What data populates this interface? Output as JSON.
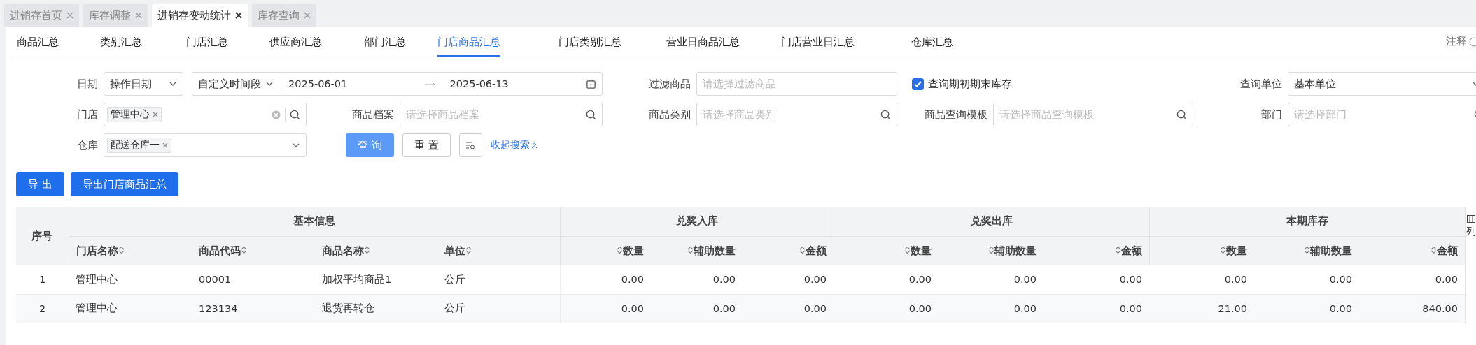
{
  "open_tabs": [
    {
      "label": "进销存首页",
      "selected": false
    },
    {
      "label": "库存调整",
      "selected": false
    },
    {
      "label": "进销存变动统计",
      "selected": true
    },
    {
      "label": "库存查询",
      "selected": false
    }
  ],
  "report_tabs": [
    {
      "label": "商品汇总",
      "selected": false
    },
    {
      "label": "类别汇总",
      "selected": false
    },
    {
      "label": "门店汇总",
      "selected": false
    },
    {
      "label": "供应商汇总",
      "selected": false
    },
    {
      "label": "部门汇总",
      "selected": false
    },
    {
      "label": "门店商品汇总",
      "selected": true
    },
    {
      "label": "门店类别汇总",
      "selected": false
    },
    {
      "label": "营业日商品汇总",
      "selected": false
    },
    {
      "label": "门店营业日汇总",
      "selected": false
    },
    {
      "label": "仓库汇总",
      "selected": false
    }
  ],
  "help_link": "注释",
  "filters": {
    "date": {
      "label": "日期",
      "type_value": "操作日期",
      "range_value": "自定义时间段",
      "start": "2025-06-01",
      "end": "2025-06-13"
    },
    "filter_goods": {
      "label": "过滤商品",
      "placeholder": "请选择过滤商品"
    },
    "opening_closing_stock": {
      "label": "查询期初期末库存",
      "checked": true
    },
    "query_unit": {
      "label": "查询单位",
      "value": "基本单位"
    },
    "store": {
      "label": "门店",
      "tags": [
        "管理中心"
      ]
    },
    "goods_file": {
      "label": "商品档案",
      "placeholder": "请选择商品档案"
    },
    "goods_category": {
      "label": "商品类别",
      "placeholder": "请选择商品类别"
    },
    "query_template": {
      "label": "商品查询模板",
      "placeholder": "请选择商品查询模板"
    },
    "department": {
      "label": "部门",
      "placeholder": "请选择部门"
    },
    "warehouse": {
      "label": "仓库",
      "tags": [
        "配送仓库一"
      ]
    }
  },
  "search_actions": {
    "query": "查 询",
    "reset": "重 置",
    "collapse": "收起搜索"
  },
  "export_buttons": [
    "导 出",
    "导出门店商品汇总"
  ],
  "table": {
    "index_label": "序号",
    "groups": [
      {
        "label": "基本信息",
        "columns": [
          "门店名称",
          "商品代码",
          "商品名称",
          "单位"
        ]
      },
      {
        "label": "兑奖入库",
        "columns": [
          "数量",
          "辅助数量",
          "金额"
        ]
      },
      {
        "label": "兑奖出库",
        "columns": [
          "数量",
          "辅助数量",
          "金额"
        ]
      },
      {
        "label": "本期库存",
        "columns": [
          "数量",
          "辅助数量",
          "金额"
        ]
      }
    ],
    "rows": [
      {
        "index": "1",
        "cells": [
          "管理中心",
          "00001",
          "加权平均商品1",
          "公斤",
          "0.00",
          "0.00",
          "0.00",
          "0.00",
          "0.00",
          "0.00",
          "0.00",
          "0.00",
          "0.00"
        ]
      },
      {
        "index": "2",
        "cells": [
          "管理中心",
          "123134",
          "退货再转仓",
          "公斤",
          "0.00",
          "0.00",
          "0.00",
          "0.00",
          "0.00",
          "0.00",
          "21.00",
          "0.00",
          "840.00"
        ]
      }
    ],
    "column_settings": "列"
  }
}
